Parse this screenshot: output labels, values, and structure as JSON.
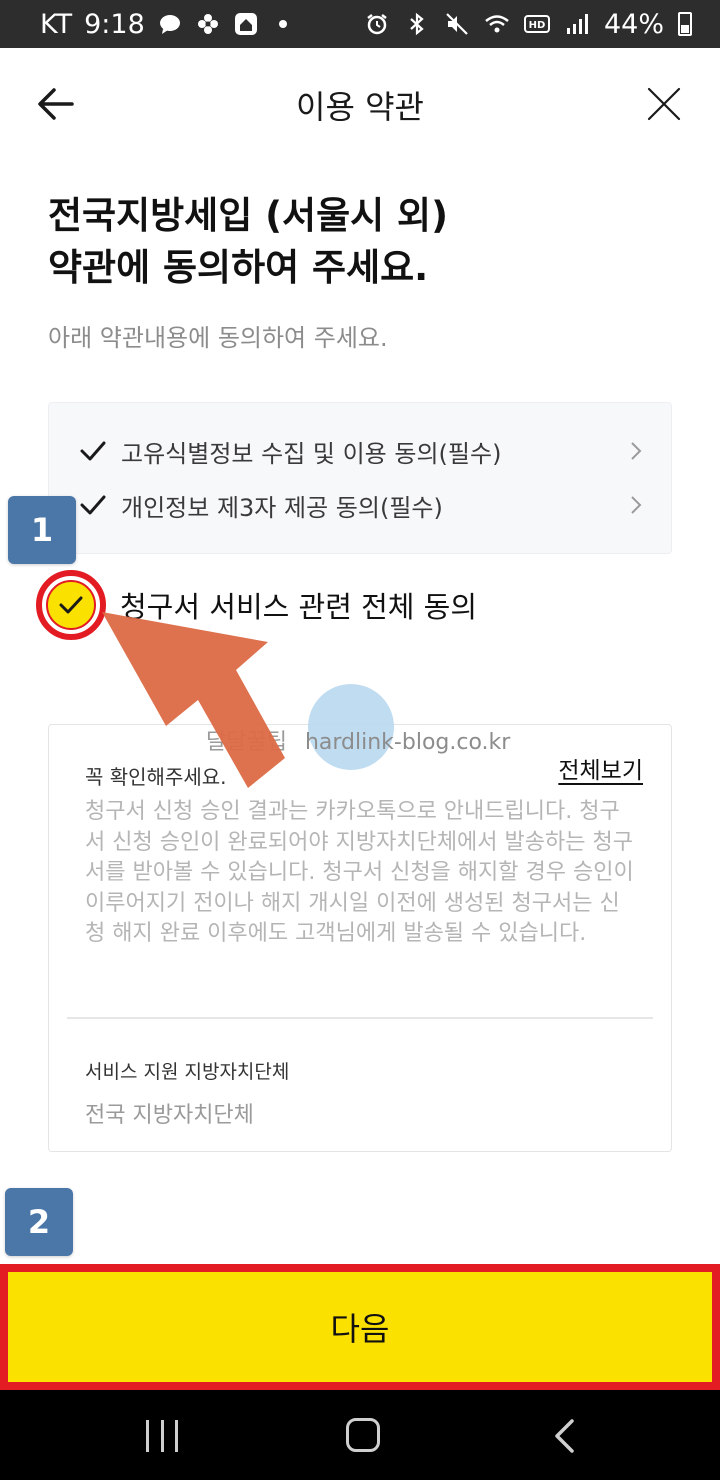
{
  "status_bar": {
    "carrier": "KT",
    "time": "9:18",
    "battery": "44%"
  },
  "header": {
    "title": "이용 약관"
  },
  "headline": {
    "line1": "전국지방세입 (서울시 외)",
    "line2": "약관에 동의하여 주세요."
  },
  "subline": "아래 약관내용에 동의하여 주세요.",
  "terms": [
    {
      "label": "고유식별정보 수집 및 이용 동의(필수)"
    },
    {
      "label": "개인정보 제3자 제공 동의(필수)"
    }
  ],
  "agree_all": {
    "label": "청구서 서비스 관련 전체 동의",
    "checked": true
  },
  "notice": {
    "title": "꼭 확인해주세요.",
    "view_all": "전체보기",
    "body": "청구서 신청 승인 결과는 카카오톡으로 안내드립니다. 청구서 신청 승인이 완료되어야 지방자치단체에서 발송하는 청구서를 받아볼 수 있습니다. 청구서 신청을 해지할 경우 승인이 이루어지기 전이나 해지 개시일 이전에 생성된 청구서는 신청 해지 완료 이후에도 고객님에게 발송될 수 있습니다.",
    "region_title": "서비스 지원 지방자치단체",
    "region_value": "전국 지방자치단체"
  },
  "watermark": {
    "text": "달달꿀팁",
    "url": "hardlink-blog.co.kr"
  },
  "badges": {
    "step1": "1",
    "step2": "2"
  },
  "next_button": {
    "label": "다음"
  },
  "colors": {
    "accent_yellow": "#fae100",
    "highlight_red": "#e31b23",
    "badge_blue": "#4a77a8",
    "arrow_orange": "#dd6a44"
  }
}
